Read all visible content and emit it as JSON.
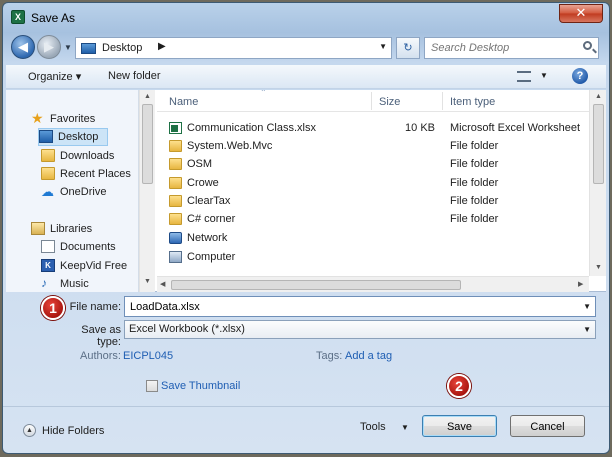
{
  "window": {
    "title": "Save As",
    "app_icon_text": "X"
  },
  "navigation": {
    "address": "Desktop",
    "search_placeholder": "Search Desktop"
  },
  "toolbar": {
    "organize_label": "Organize ▾",
    "new_folder_label": "New folder"
  },
  "sidebar": {
    "items": [
      {
        "label": "Favorites",
        "icon": "star-icon",
        "selected": false
      },
      {
        "label": "Desktop",
        "icon": "desktop-icon",
        "selected": true
      },
      {
        "label": "Downloads",
        "icon": "downloads-folder-icon",
        "selected": false
      },
      {
        "label": "Recent Places",
        "icon": "recent-places-icon",
        "selected": false
      },
      {
        "label": "OneDrive",
        "icon": "onedrive-cloud-icon",
        "selected": false
      },
      {
        "label": "Libraries",
        "icon": "libraries-icon",
        "selected": false
      },
      {
        "label": "Documents",
        "icon": "documents-icon",
        "selected": false
      },
      {
        "label": "KeepVid Free",
        "icon": "keepvid-icon",
        "selected": false
      },
      {
        "label": "Music",
        "icon": "music-icon",
        "selected": false
      }
    ]
  },
  "file_list": {
    "columns": {
      "name": "Name",
      "size": "Size",
      "type": "Item type"
    },
    "rows": [
      {
        "name": "Communication Class.xlsx",
        "size": "10 KB",
        "type": "Microsoft Excel Worksheet",
        "icon": "excel-file-icon"
      },
      {
        "name": "System.Web.Mvc",
        "size": "",
        "type": "File folder",
        "icon": "folder-icon"
      },
      {
        "name": "OSM",
        "size": "",
        "type": "File folder",
        "icon": "folder-icon"
      },
      {
        "name": "Crowe",
        "size": "",
        "type": "File folder",
        "icon": "folder-icon"
      },
      {
        "name": "ClearTax",
        "size": "",
        "type": "File folder",
        "icon": "folder-icon"
      },
      {
        "name": "C# corner",
        "size": "",
        "type": "File folder",
        "icon": "folder-icon"
      },
      {
        "name": "Network",
        "size": "",
        "type": "",
        "icon": "network-icon"
      },
      {
        "name": "Computer",
        "size": "",
        "type": "",
        "icon": "computer-icon"
      }
    ]
  },
  "form": {
    "file_name_label": "File name:",
    "file_name_value": "LoadData.xlsx",
    "save_type_label": "Save as type:",
    "save_type_value": "Excel Workbook (*.xlsx)",
    "authors_label": "Authors:",
    "authors_value": "EICPL045",
    "tags_label": "Tags:",
    "tags_value": "Add a tag",
    "save_thumbnail_label": "Save Thumbnail",
    "save_thumbnail_checked": false
  },
  "footer": {
    "hide_folders_label": "Hide Folders",
    "tools_label": "Tools",
    "save_label": "Save",
    "cancel_label": "Cancel"
  },
  "annotations": {
    "step1": "1",
    "step2": "2"
  },
  "colors": {
    "accent_link": "#1f5eb3",
    "selection": "#cce4f7",
    "badge_red": "#c4201a",
    "excel_green": "#1e7145"
  }
}
